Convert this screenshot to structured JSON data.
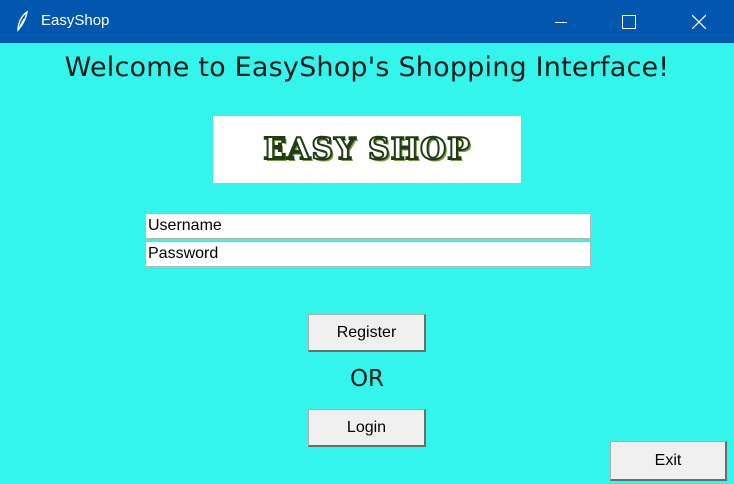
{
  "window": {
    "title": "EasyShop",
    "icons": {
      "app": "feather-icon",
      "minimize": "minimize-icon",
      "maximize": "maximize-icon",
      "close": "close-icon"
    }
  },
  "main": {
    "heading": "Welcome to EasyShop's Shopping Interface!",
    "logo_text": "EASY SHOP",
    "username_value": "Username",
    "password_value": "Password",
    "register_label": "Register",
    "or_label": "OR",
    "login_label": "Login",
    "exit_label": "Exit"
  },
  "colors": {
    "background": "#34f5ec",
    "titlebar": "#0057ad",
    "logo_green": "#1f3c16"
  }
}
